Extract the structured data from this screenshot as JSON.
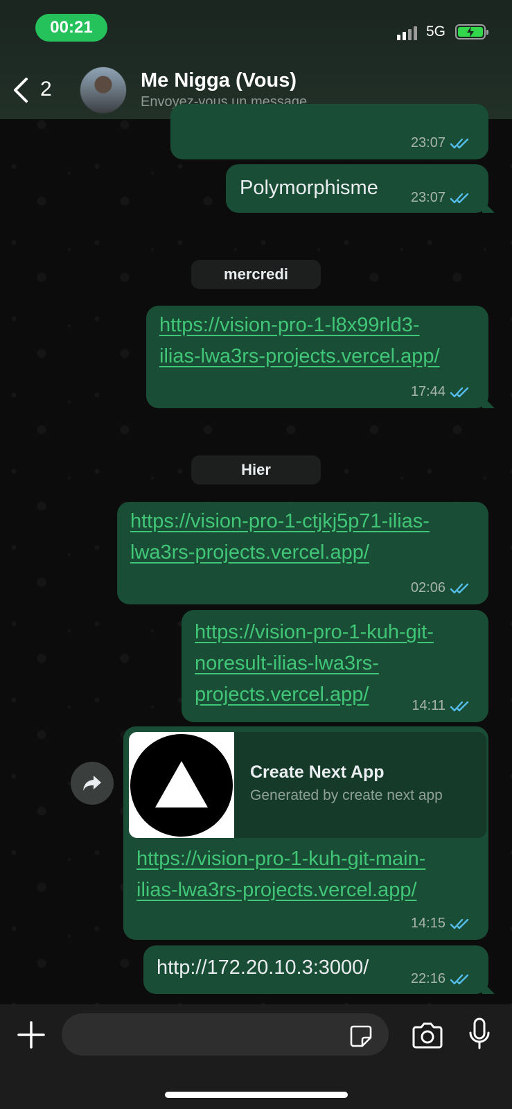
{
  "status_bar": {
    "time": "00:21",
    "network": "5G",
    "battery_charging": true,
    "accent_color": "#25c25b"
  },
  "header": {
    "back_count": "2",
    "contact_name": "Me Nigga (Vous)",
    "subtitle": "Envoyez-vous un message"
  },
  "messages": [
    {
      "time": "23:07",
      "status": "read"
    },
    {
      "text": "Polymorphisme",
      "time": "23:07",
      "status": "read"
    },
    {
      "divider": "mercredi"
    },
    {
      "link_line1": "https://vision-pro-1-l8x99rld3-",
      "link_line2": "ilias-lwa3rs-projects.vercel.app/",
      "time": "17:44",
      "status": "read"
    },
    {
      "divider": "Hier"
    },
    {
      "link_line1": "https://vision-pro-1-ctjkj5p71-ilias-",
      "link_line2": "lwa3rs-projects.vercel.app/",
      "time": "02:06",
      "status": "read"
    },
    {
      "link_line1": "https://vision-pro-1-kuh-git-",
      "link_line2": "noresult-ilias-lwa3rs-",
      "link_line3": "projects.vercel.app/",
      "time": "14:11",
      "status": "read"
    },
    {
      "preview_title": "Create Next App",
      "preview_desc": "Generated by create next app",
      "link_line1": "https://vision-pro-1-kuh-git-main-",
      "link_line2": "ilias-lwa3rs-projects.vercel.app/",
      "time": "14:15",
      "status": "read"
    },
    {
      "text": "http://172.20.10.3:3000/",
      "time": "22:16",
      "status": "read"
    }
  ],
  "input": {
    "placeholder": ""
  },
  "colors": {
    "bubble_outgoing": "#1a4d36",
    "link": "#40c676",
    "read_ticks": "#53bdeb"
  },
  "icons": [
    "chevron-left-icon",
    "forward-icon",
    "plus-icon",
    "sticker-icon",
    "camera-icon",
    "microphone-icon"
  ]
}
